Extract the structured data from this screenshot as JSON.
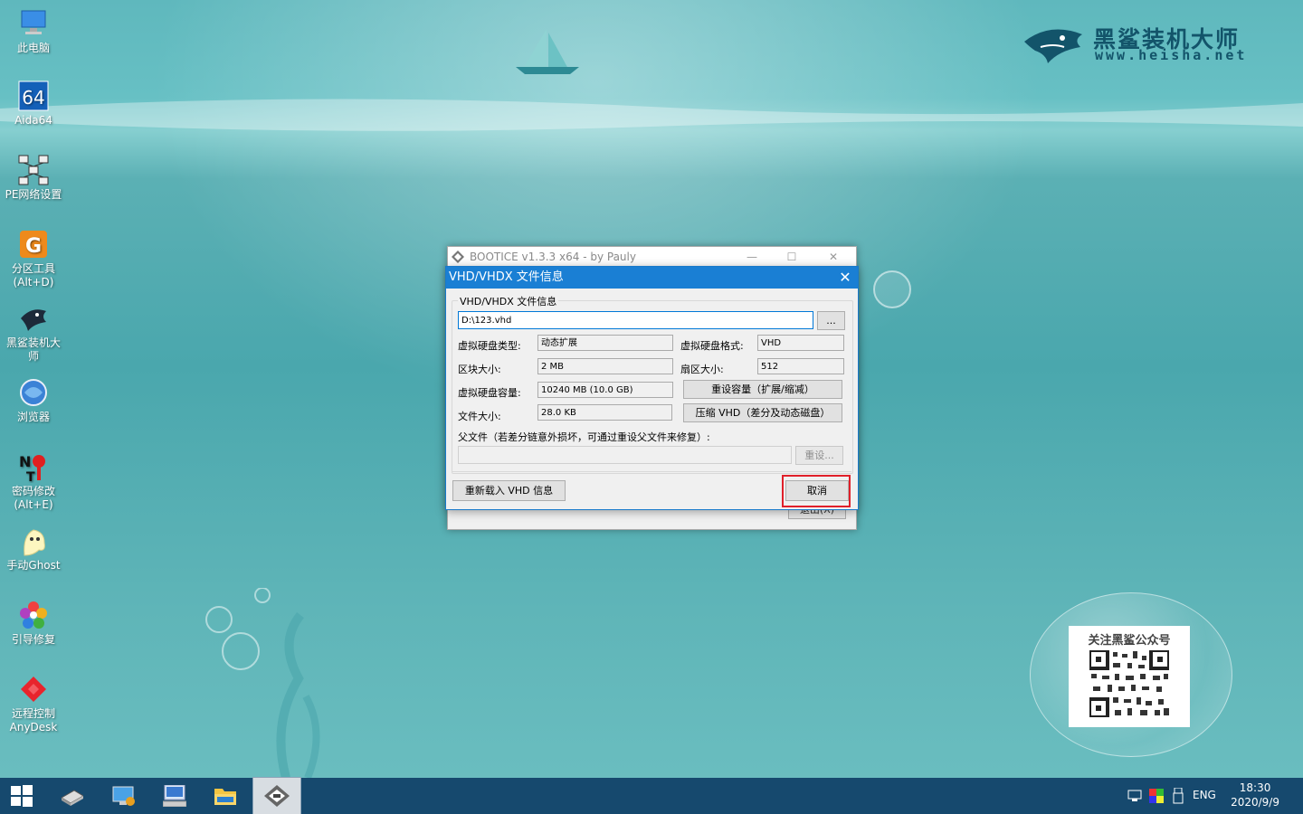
{
  "desktop_icons": [
    {
      "label": "此电脑",
      "icon": "computer-icon"
    },
    {
      "label": "Aida64",
      "icon": "aida64-icon"
    },
    {
      "label": "PE网络设置",
      "icon": "network-icon"
    },
    {
      "label": "分区工具\n(Alt+D)",
      "icon": "partition-icon"
    },
    {
      "label": "黑鲨装机大\n师",
      "icon": "heisha-icon"
    },
    {
      "label": "浏览器",
      "icon": "browser-icon"
    },
    {
      "label": "密码修改\n(Alt+E)",
      "icon": "password-icon"
    },
    {
      "label": "手动Ghost",
      "icon": "ghost-icon"
    },
    {
      "label": "引导修复",
      "icon": "boot-repair-icon"
    },
    {
      "label": "远程控制\nAnyDesk",
      "icon": "anydesk-icon"
    }
  ],
  "brand": {
    "name": "黑鲨装机大师",
    "url": "www.heisha.net"
  },
  "qr": {
    "title": "关注黑鲨公众号"
  },
  "back_window": {
    "title": "BOOTICE v1.3.3 x64 - by Pauly",
    "minimize": "—",
    "maximize": "☐",
    "close": "✕",
    "exit_button": "退出(X)"
  },
  "dialog": {
    "title": "VHD/VHDX 文件信息",
    "close": "✕",
    "group_label": "VHD/VHDX 文件信息",
    "path_value": "D:\\123.vhd",
    "browse_button": "...",
    "disk_type_label": "虚拟硬盘类型:",
    "disk_type_value": "动态扩展",
    "disk_format_label": "虚拟硬盘格式:",
    "disk_format_value": "VHD",
    "block_size_label": "区块大小:",
    "block_size_value": "2 MB",
    "sector_size_label": "扇区大小:",
    "sector_size_value": "512",
    "capacity_label": "虚拟硬盘容量:",
    "capacity_value": "10240 MB (10.0 GB)",
    "resize_button": "重设容量（扩展/缩减）",
    "file_size_label": "文件大小:",
    "file_size_value": "28.0 KB",
    "compress_button": "压缩 VHD（差分及动态磁盘）",
    "parent_label": "父文件（若差分链意外损坏，可通过重设父文件来修复）:",
    "parent_value": "",
    "reset_button": "重设...",
    "reload_button": "重新载入 VHD 信息",
    "cancel_button": "取消"
  },
  "taskbar": {
    "start": "start-icon",
    "lang": "ENG",
    "time": "18:30",
    "date": "2020/9/9"
  },
  "colors": {
    "accent": "#1a7fd4",
    "highlight": "#e0202a",
    "taskbar": "#16496e"
  }
}
